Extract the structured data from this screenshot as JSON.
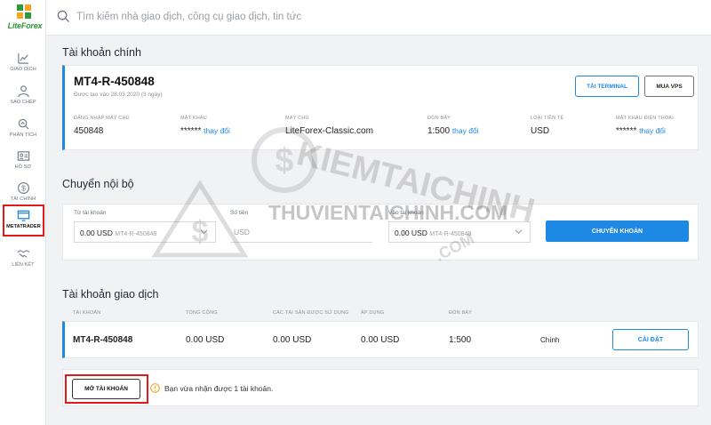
{
  "brand": {
    "logo_text": "LiteForex",
    "accent": "#1e88e5",
    "logo_green": "#2e9a3a",
    "highlight": "#e0191b"
  },
  "search": {
    "placeholder": "Tìm kiếm nhà giao dịch, công cụ giao dịch, tin tức"
  },
  "sidebar": {
    "items": [
      {
        "label": "GIAO DỊCH",
        "icon": "chart-line-icon",
        "active": false
      },
      {
        "label": "SAO CHÉP",
        "icon": "users-icon",
        "active": false
      },
      {
        "label": "PHÂN TÍCH",
        "icon": "analytics-icon",
        "active": false
      },
      {
        "label": "HỒ SƠ",
        "icon": "id-card-icon",
        "active": false
      },
      {
        "label": "TÀI CHÍNH",
        "icon": "dollar-circle-icon",
        "active": false
      },
      {
        "label": "METATRADER",
        "icon": "monitor-icon",
        "active": true
      },
      {
        "label": "LIÊN KẾT",
        "icon": "handshake-icon",
        "active": false
      }
    ]
  },
  "main_account": {
    "section_title": "Tài khoản chính",
    "account_id": "MT4-R-450848",
    "created": "Được tạo vào 28.03.2020 (3 ngày)",
    "terminal_button": "TẢI TERMINAL",
    "vps_button": "MUA VPS",
    "fields": [
      {
        "label": "ĐĂNG NHẬP MÁY CHỦ",
        "value": "450848",
        "link": ""
      },
      {
        "label": "MẬT KHẨU",
        "value": "******",
        "link": "thay đổi"
      },
      {
        "label": "MÁY CHỦ",
        "value": "LiteForex-Classic.com",
        "link": ""
      },
      {
        "label": "ĐÒN BẨY",
        "value": "1:500",
        "link": "thay đổi"
      },
      {
        "label": "LOẠI TIỀN TỆ",
        "value": "USD",
        "link": ""
      },
      {
        "label": "MẬT KHẨU ĐIỆN THOẠI",
        "value": "******",
        "link": "thay đổi"
      }
    ]
  },
  "transfer": {
    "section_title": "Chuyển nội bộ",
    "from_label": "Từ tài khoản",
    "from_amount": "0.00 USD",
    "from_account": "MT4-R-450848",
    "amount_label": "Số tiền",
    "amount_placeholder": "USD",
    "to_label": "Vào tài khoản",
    "to_amount": "0.00 USD",
    "to_account": "MT4-R-450848",
    "button": "CHUYỂN KHOẢN"
  },
  "trading_accounts": {
    "section_title": "Tài khoản giao dịch",
    "columns": [
      "TÀI KHOẢN",
      "TỔNG CỘNG",
      "CÁC TÀI SẢN ĐƯỢC SỬ DỤNG",
      "ÁP DỤNG",
      "ĐÒN BẨY"
    ],
    "rows": [
      {
        "account": "MT4-R-450848",
        "total": "0.00 USD",
        "used": "0.00 USD",
        "applied": "0.00 USD",
        "leverage": "1:500",
        "status": "Chính",
        "button": "CÀI ĐẶT"
      }
    ]
  },
  "open_account": {
    "button": "MỞ TÀI KHOẢN",
    "notice": "Bạn vừa nhận được 1 tài khoản."
  },
  "watermark": {
    "line1": "KIEMTAICHINH",
    "line2": "THUVIENTAICHINH.COM",
    "line3": ".COM"
  }
}
